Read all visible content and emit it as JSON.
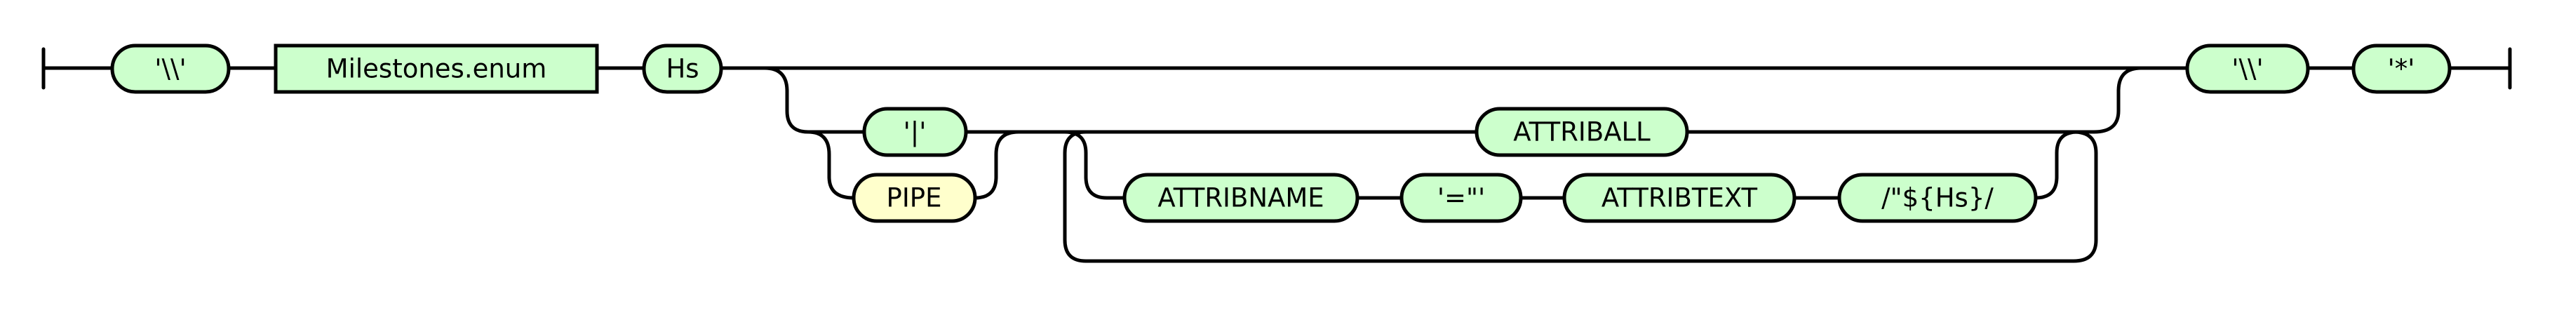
{
  "diagram": {
    "nodes": [
      {
        "id": "start_sep",
        "label": "'\\\\'",
        "kind": "terminal"
      },
      {
        "id": "milestones",
        "label": "Milestones.enum",
        "kind": "nonterminal"
      },
      {
        "id": "hs",
        "label": "Hs",
        "kind": "terminal"
      },
      {
        "id": "pipe_lit",
        "label": "'|'",
        "kind": "terminal"
      },
      {
        "id": "pipe_ref",
        "label": "PIPE",
        "kind": "reference"
      },
      {
        "id": "attriball",
        "label": "ATTRIBALL",
        "kind": "terminal"
      },
      {
        "id": "attribname",
        "label": "ATTRIBNAME",
        "kind": "terminal"
      },
      {
        "id": "eq_quote",
        "label": "'=\"'",
        "kind": "terminal"
      },
      {
        "id": "attribtext",
        "label": "ATTRIBTEXT",
        "kind": "terminal"
      },
      {
        "id": "regex_hs",
        "label": "/\"${Hs}/",
        "kind": "terminal"
      },
      {
        "id": "end_sep",
        "label": "'\\\\'",
        "kind": "terminal"
      },
      {
        "id": "star",
        "label": "'*'",
        "kind": "terminal"
      }
    ],
    "colors": {
      "terminal_fill": "#ccffcc",
      "nonterminal_fill": "#ccffcc",
      "reference_fill": "#ffffcc",
      "stroke": "#000000"
    }
  }
}
